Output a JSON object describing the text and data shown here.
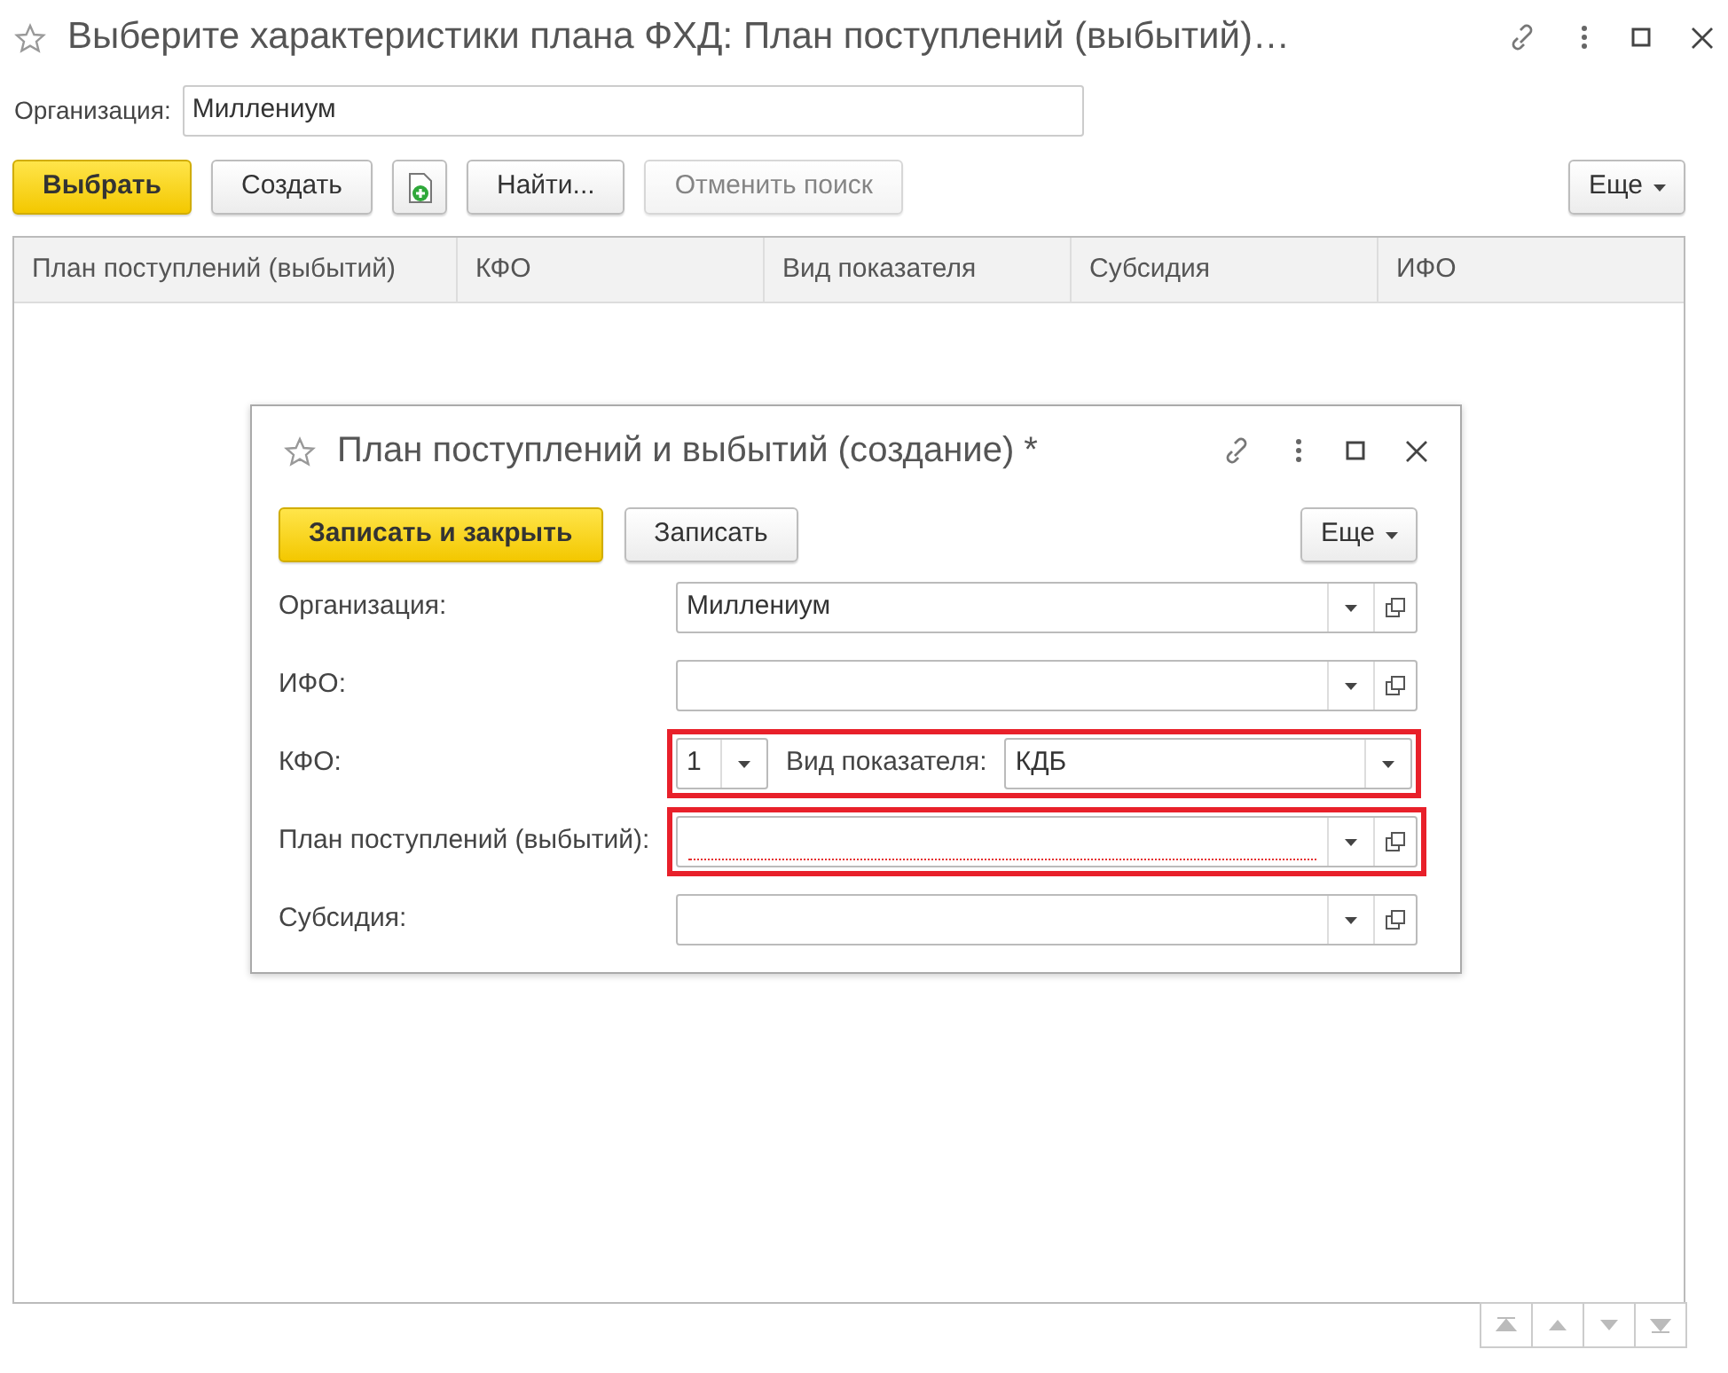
{
  "window": {
    "title": "Выберите характеристики плана ФХД: План поступлений (выбытий)…"
  },
  "filter": {
    "label": "Организация:",
    "value": "Миллениум"
  },
  "toolbar": [
    {
      "kind": "primary",
      "label": "Выбрать",
      "disabled": false
    },
    {
      "kind": "button",
      "label": "Создать",
      "disabled": false
    },
    {
      "kind": "icon",
      "disabled": false
    },
    {
      "kind": "button",
      "label": "Найти...",
      "disabled": false
    },
    {
      "kind": "button",
      "label": "Отменить поиск",
      "disabled": true
    },
    {
      "kind": "menu",
      "label": "Еще",
      "disabled": false
    }
  ],
  "table": {
    "columns": [
      "План поступлений (выбытий)",
      "КФО",
      "Вид показателя",
      "Субсидия",
      "ИФО"
    ]
  },
  "dialog": {
    "title": "План поступлений и выбытий (создание) *",
    "buttons": [
      {
        "kind": "primary",
        "label": "Записать и закрыть"
      },
      {
        "kind": "button",
        "label": "Записать"
      },
      {
        "kind": "menu",
        "label": "Еще"
      }
    ],
    "fields": [
      {
        "kind": "select",
        "label": "Организация:",
        "value": "Миллениум",
        "highlighted": false,
        "required_empty": false
      },
      {
        "kind": "select",
        "label": "ИФО:",
        "highlighted": false,
        "required_empty": false
      },
      {
        "kind": "pair",
        "label": "КФО:",
        "value": "1",
        "second_label": "Вид показателя:",
        "second_value": "КДБ",
        "highlighted": true,
        "required_empty": false
      },
      {
        "kind": "select",
        "label": "План поступлений (выбытий):",
        "highlighted": true,
        "required_empty": true
      },
      {
        "kind": "select",
        "label": "Субсидия:",
        "highlighted": false,
        "required_empty": false
      }
    ]
  }
}
